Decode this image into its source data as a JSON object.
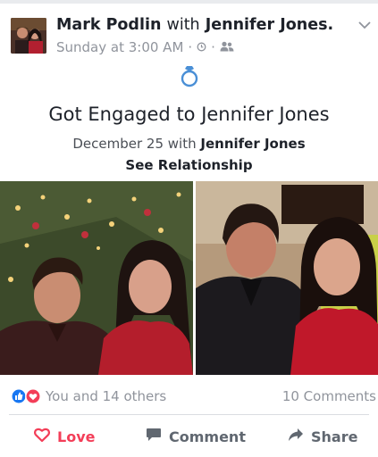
{
  "post": {
    "author": "Mark Podlin",
    "with_word": "with",
    "tagged": "Jennifer Jones.",
    "timestamp": "Sunday at 3:00 AM",
    "separator": "·",
    "audience_icon": "friends-icon",
    "location_icon": "clock-icon"
  },
  "life_event": {
    "icon": "engagement-ring-icon",
    "title": "Got Engaged to Jennifer Jones",
    "date": "December 25",
    "with_word": "with",
    "with_name": "Jennifer Jones",
    "link": "See Relationship"
  },
  "reactions": {
    "icons": [
      "like-icon",
      "love-icon"
    ],
    "summary": "You and 14 others",
    "comments": "10 Comments"
  },
  "actions": [
    {
      "label": "Love",
      "icon": "heart-icon",
      "active": true
    },
    {
      "label": "Comment",
      "icon": "comment-icon",
      "active": false
    },
    {
      "label": "Share",
      "icon": "share-icon",
      "active": false
    }
  ],
  "colors": {
    "love": "#f33e58",
    "like": "#1877f2",
    "muted": "#90949c",
    "ring": "#4a8fd6"
  }
}
